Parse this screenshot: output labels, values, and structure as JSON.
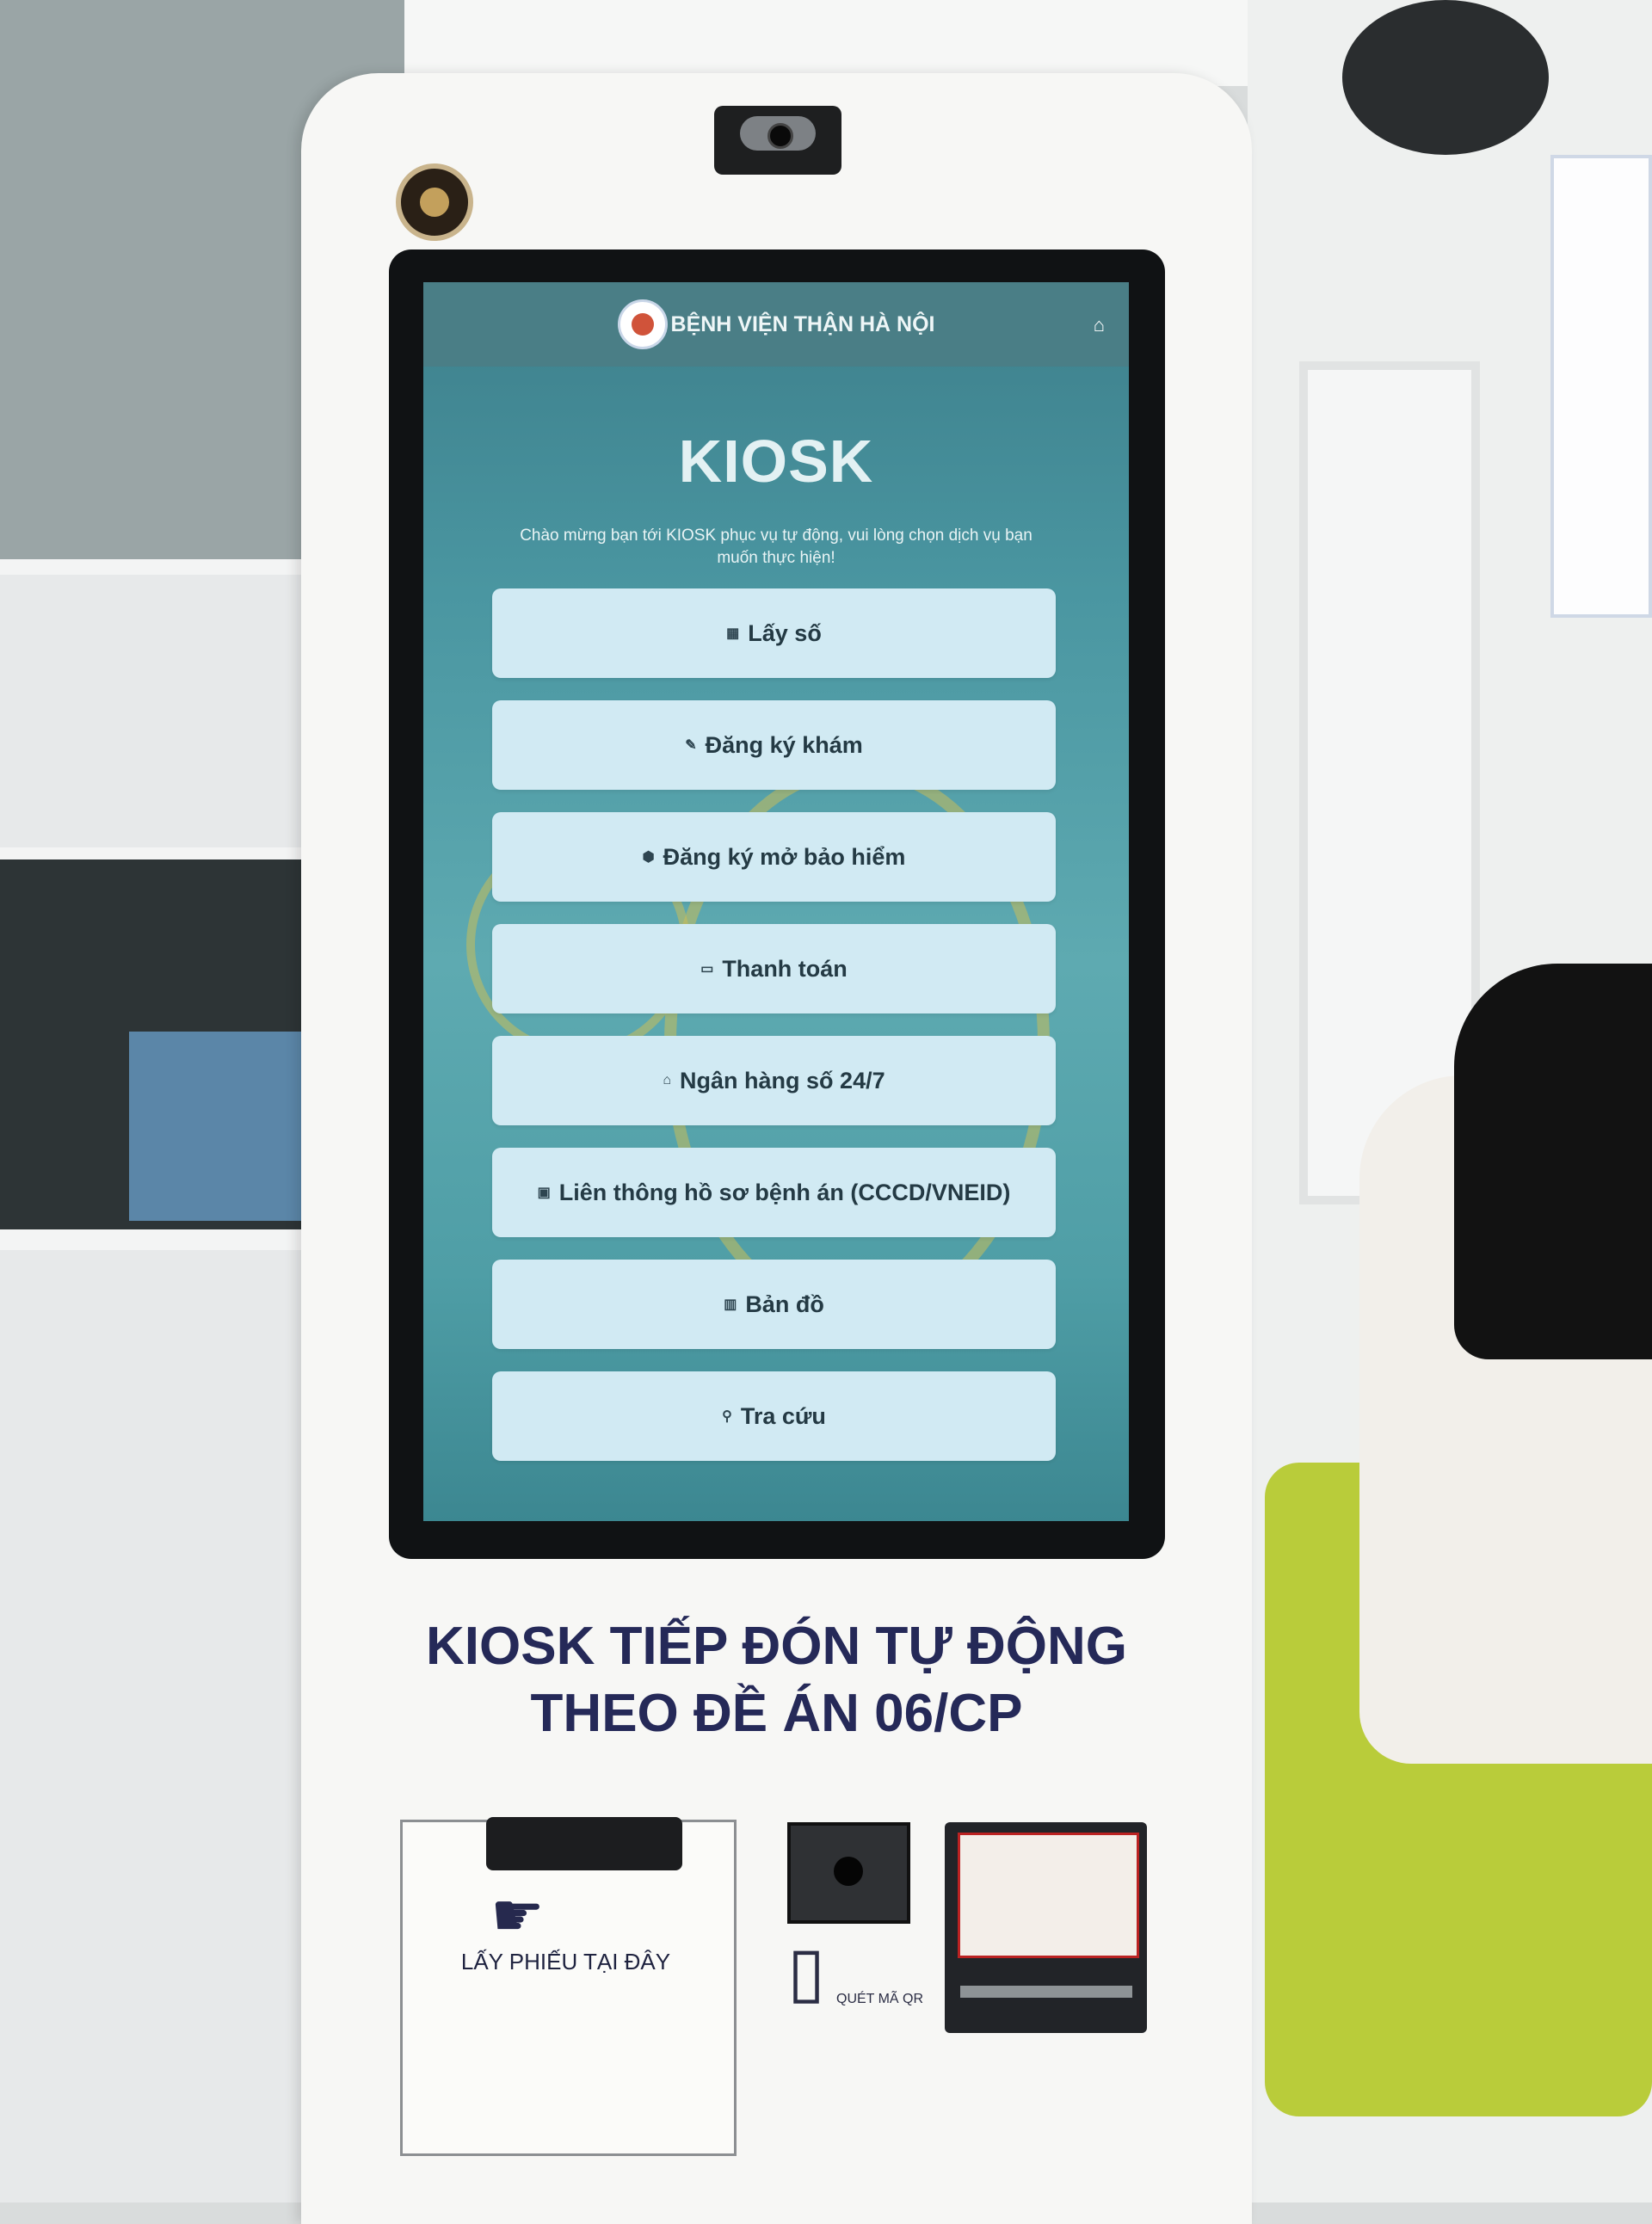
{
  "header": {
    "hospital_name": "BỆNH VIỆN THẬN HÀ NỘI"
  },
  "main": {
    "title": "KIOSK",
    "welcome": "Chào mừng bạn tới KIOSK phục vụ tự động, vui lòng chọn dịch vụ bạn muốn thực hiện!"
  },
  "menu": {
    "items": [
      {
        "icon": "ticket-icon",
        "glyph": "▦",
        "label": "Lấy số"
      },
      {
        "icon": "edit-icon",
        "glyph": "✎",
        "label": "Đăng ký khám"
      },
      {
        "icon": "shield-icon",
        "glyph": "⬢",
        "label": "Đăng ký mở bảo hiểm"
      },
      {
        "icon": "card-icon",
        "glyph": "▭",
        "label": "Thanh toán"
      },
      {
        "icon": "bank-icon",
        "glyph": "⌂",
        "label": "Ngân hàng số 24/7"
      },
      {
        "icon": "id-card-icon",
        "glyph": "▣",
        "label": "Liên thông hồ sơ bệnh án (CCCD/VNEID)"
      },
      {
        "icon": "map-icon",
        "glyph": "▥",
        "label": "Bản đồ"
      },
      {
        "icon": "search-icon",
        "glyph": "⚲",
        "label": "Tra cứu"
      }
    ]
  },
  "kiosk_panel": {
    "slogan_line1": "KIOSK TIẾP ĐÓN TỰ ĐỘNG",
    "slogan_line2": "THEO ĐỀ ÁN 06/CP",
    "ticket_label": "LẤY PHIẾU TẠI ĐÂY",
    "qr_label": "QUÉT MÃ QR"
  }
}
